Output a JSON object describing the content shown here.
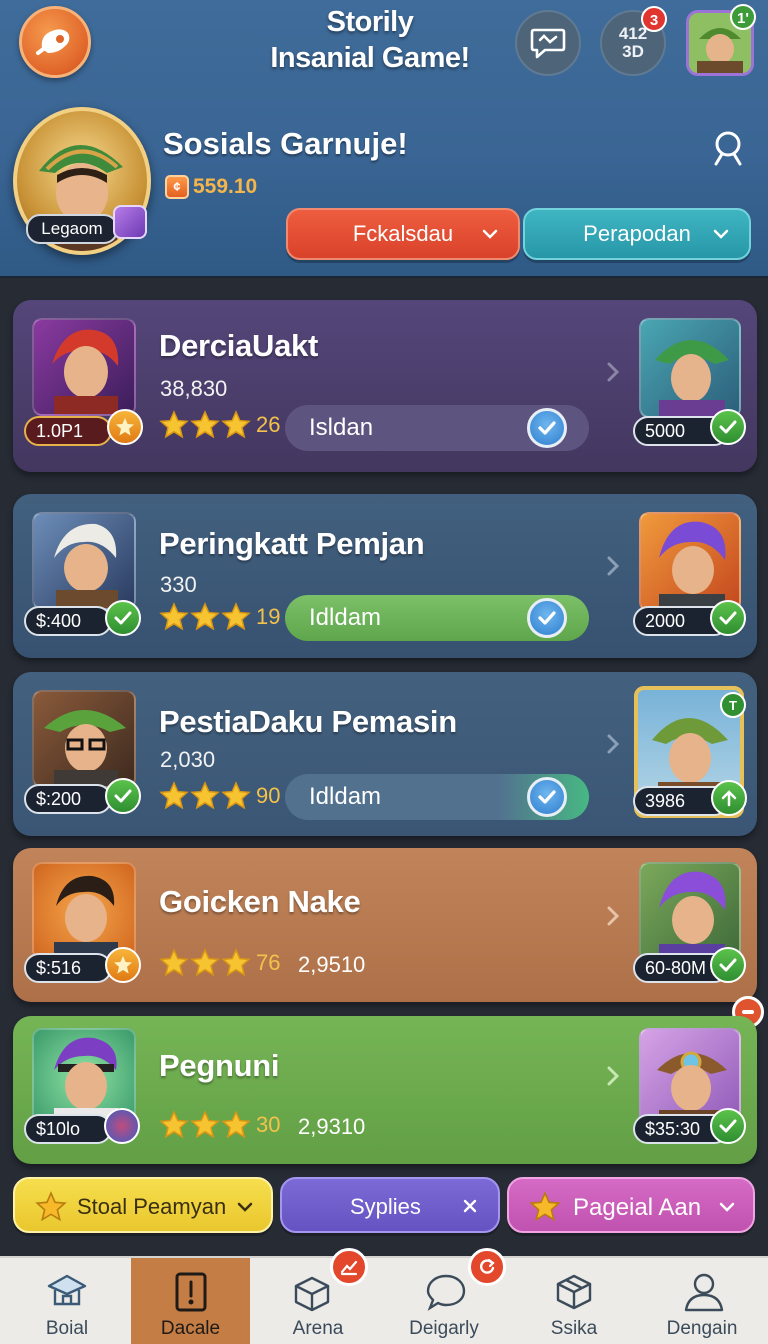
{
  "header": {
    "title_line1": "Storily",
    "title_line2": "Insanial Game!",
    "stats_line1": "412",
    "stats_line2": "3D",
    "stats_badge": "3",
    "avatar_badge": "1'"
  },
  "profile": {
    "tag": "Legaom",
    "name": "Sosials Garnuje!",
    "coins": "559.10",
    "dropdown_left": "Fckalsdau",
    "dropdown_right": "Perapodan"
  },
  "cards": [
    {
      "name": "DerciaUakt",
      "score": "38,830",
      "rank": "1.0P1",
      "stars_count": "26",
      "pill_label": "Isldan",
      "right_tag": "5000",
      "colors": {
        "bg": "#4c3f6d",
        "pill": "#5d5480"
      }
    },
    {
      "name": "Peringkatt Pemjan",
      "score": "330",
      "rank": "$:400",
      "stars_count": "19",
      "pill_label": "Idldam",
      "right_tag": "2000",
      "colors": {
        "bg": "#3d5573",
        "pill": "#6fb45a"
      }
    },
    {
      "name": "PestiaDaku Pemasin",
      "score": "2,030",
      "rank": "$:200",
      "stars_count": "90",
      "pill_label": "Idldam",
      "right_tag": "3986",
      "right_badge": "T",
      "colors": {
        "bg": "#3e5877",
        "pill": "#52718f"
      }
    },
    {
      "name": "Goicken Nake",
      "rank": "$:516",
      "stars_count": "76",
      "extra": "2,9510",
      "right_tag": "60-80M",
      "colors": {
        "bg": "#b77a51"
      }
    },
    {
      "name": "Pegnuni",
      "rank": "$10lo",
      "stars_count": "30",
      "extra": "2,9310",
      "right_tag": "$35:30",
      "colors": {
        "bg": "#6aa94c"
      }
    }
  ],
  "filters": {
    "left": "Stoal Peamyan",
    "middle": "Syplies",
    "right": "Pageial Aan"
  },
  "tabs": [
    {
      "label": "Boial",
      "icon": "school-icon"
    },
    {
      "label": "Dacale",
      "icon": "door-icon"
    },
    {
      "label": "Arena",
      "icon": "arena-box-icon"
    },
    {
      "label": "Deigarly",
      "icon": "chat-bubble-icon"
    },
    {
      "label": "Ssika",
      "icon": "package-icon"
    },
    {
      "label": "Dengain",
      "icon": "user-icon"
    }
  ],
  "active_tab": "Dacale"
}
